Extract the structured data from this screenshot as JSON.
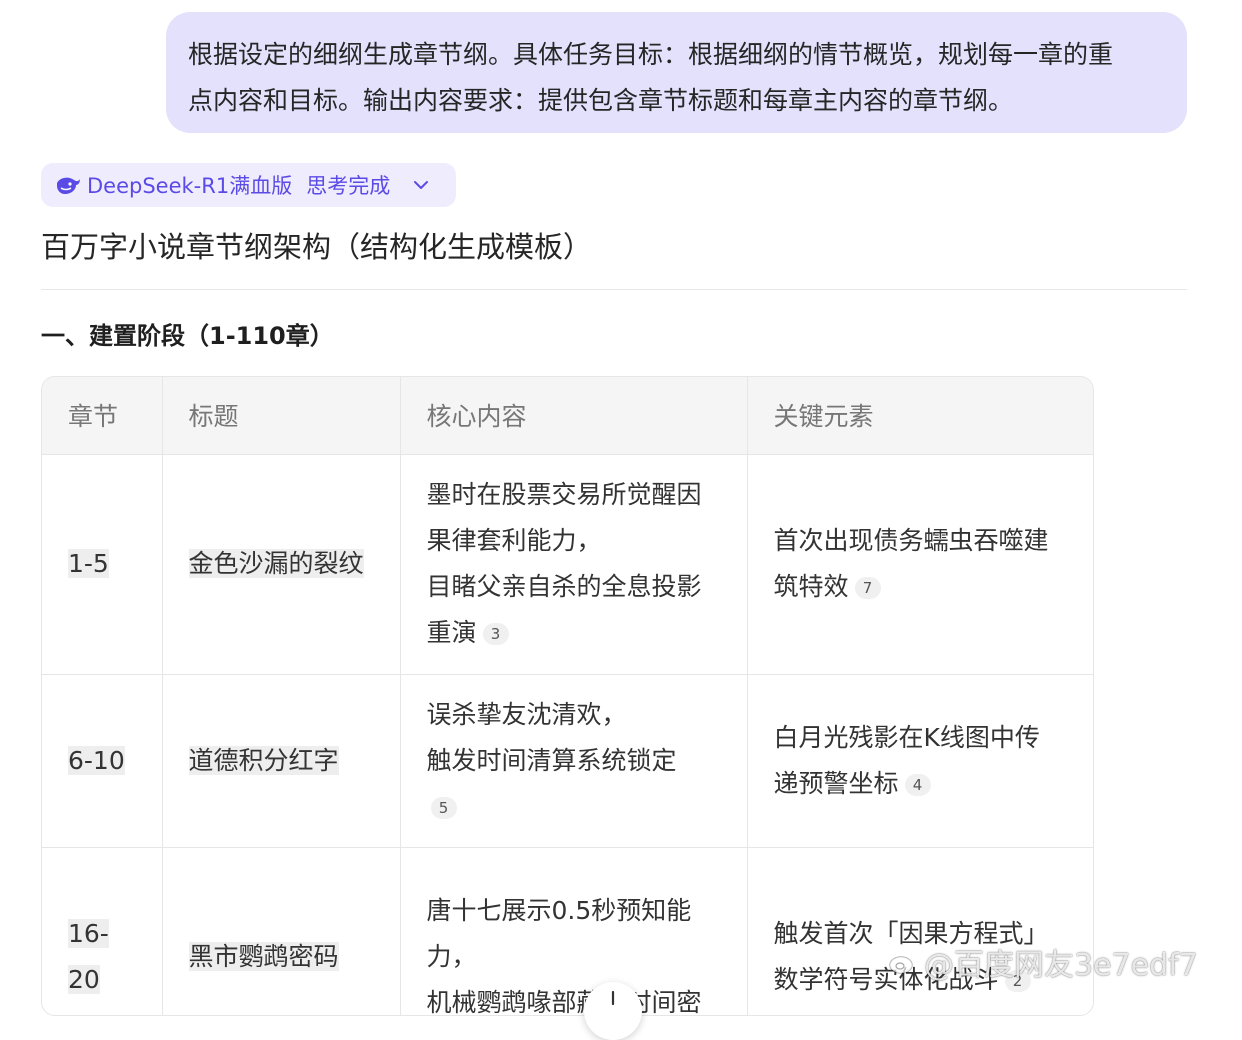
{
  "user_message": {
    "line1": "根据设定的细纲生成章节纲。具体任务目标：根据细纲的情节概览，规划每一章的重",
    "line2": "点内容和目标。输出内容要求：提供包含章节标题和每章主内容的章节纲。"
  },
  "model_chip": {
    "model": "DeepSeek-R1满血版",
    "status": "思考完成",
    "icon": "deepseek-whale-icon",
    "accent": "#5b4be6"
  },
  "response": {
    "title": "百万字小说章节纲架构（结构化生成模板）",
    "section_heading": "一、建置阶段（1-110章）"
  },
  "table": {
    "headers": [
      "章节",
      "标题",
      "核心内容",
      "关键元素"
    ],
    "rows": [
      {
        "chapter": "1-5",
        "title": "金色沙漏的裂纹",
        "content": [
          "墨时在股票交易所觉醒因",
          "果律套利能力，",
          "目睹父亲自杀的全息投影",
          "重演"
        ],
        "content_cite": "3",
        "elements": [
          "首次出现债务蠕虫吞噬建",
          "筑特效"
        ],
        "elements_cite": "7"
      },
      {
        "chapter": "6-10",
        "title": "道德积分红字",
        "content": [
          "误杀挚友沈清欢，",
          "触发时间清算系统锁定"
        ],
        "content_cite": "5",
        "elements": [
          "白月光残影在K线图中传",
          "递预警坐标"
        ],
        "elements_cite": "4"
      },
      {
        "chapter": "16-20",
        "title": "黑市鹦鹉密码",
        "content": [
          "唐十七展示0.5秒预知能",
          "力，",
          "机械鹦鹉喙部藏有时间密"
        ],
        "elements": [
          "触发首次「因果方程式」",
          "数学符号实体化战斗"
        ],
        "elements_cite": "2"
      }
    ]
  },
  "watermark": "@百度网友3e7edf7"
}
